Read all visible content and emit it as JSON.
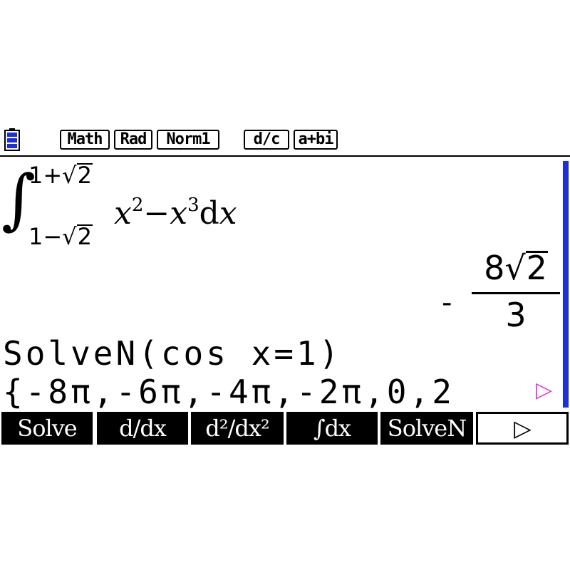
{
  "status_bar": {
    "indicators": [
      "Math",
      "Rad",
      "Norm1",
      "d/c",
      "a+bi"
    ]
  },
  "expression1": {
    "upper_limit_prefix": "1+",
    "upper_limit_radicand": "2",
    "lower_limit_prefix": "1−",
    "lower_limit_radicand": "2",
    "integrand_part1": "x",
    "exp1": "2",
    "integrand_minus": "−",
    "integrand_part2": "x",
    "exp2": "3",
    "differential": "d",
    "differential_var": "x"
  },
  "result1": {
    "sign": "-",
    "numerator_coeff": "8",
    "numerator_radicand": "2",
    "denominator": "3"
  },
  "expression2": {
    "text": "SolveN(cos x=1)"
  },
  "result2": {
    "text": "{-8π,-6π,-4π,-2π,0,2"
  },
  "scroll_arrow": "▷",
  "function_keys": [
    {
      "label": "Solve"
    },
    {
      "label": "d/dx"
    },
    {
      "label": "d²/dx²"
    },
    {
      "label": "∫dx"
    },
    {
      "label": "SolveN"
    },
    {
      "label": "▷"
    }
  ],
  "colors": {
    "battery": "#1d2fd6",
    "scrollbar": "#1d2fd6",
    "scroll_arrow": "#e62ee6"
  }
}
